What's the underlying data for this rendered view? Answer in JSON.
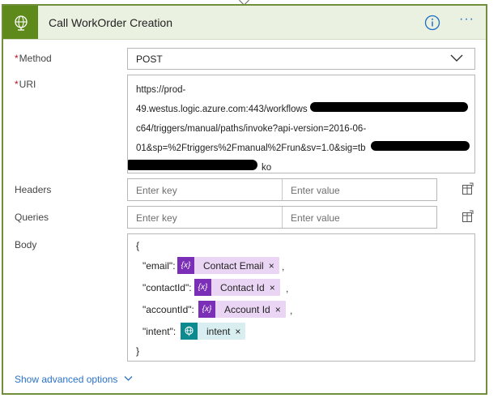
{
  "action": {
    "title": "Call WorkOrder Creation",
    "icon": "globe-icon",
    "info_icon": "info-icon",
    "more_label": "···"
  },
  "method": {
    "label": "Method",
    "required_mark": "*",
    "value": "POST"
  },
  "uri": {
    "label": "URI",
    "required_mark": "*",
    "lines": [
      "https://prod-",
      "49.westus.logic.azure.com:443/workflows",
      "c64/triggers/manual/paths/invoke?api-version=2016-06-",
      "01&sp=%2Ftriggers%2Fmanual%2Frun&sv=1.0&sig=tb",
      "ko"
    ]
  },
  "headers": {
    "label": "Headers",
    "key_placeholder": "Enter key",
    "value_placeholder": "Enter value"
  },
  "queries": {
    "label": "Queries",
    "key_placeholder": "Enter key",
    "value_placeholder": "Enter value"
  },
  "body": {
    "label": "Body",
    "open_brace": "{",
    "close_brace": "}",
    "fields": [
      {
        "key": "\"email\":",
        "token": "Contact Email",
        "token_type": "expression",
        "comma": ","
      },
      {
        "key": "\"contactId\":",
        "token": "Contact Id",
        "token_type": "expression",
        "comma": ","
      },
      {
        "key": "\"accountId\":",
        "token": "Account Id",
        "token_type": "expression",
        "comma": ","
      },
      {
        "key": "\"intent\":",
        "token": "intent",
        "token_type": "http",
        "comma": ""
      }
    ],
    "token_expression_icon": "{x}",
    "remove_glyph": "×"
  },
  "advanced": {
    "label": "Show advanced options"
  },
  "colors": {
    "header_bg": "#eaf1e1",
    "accent_green": "#5d8a1b",
    "border_green": "#6f8f3b",
    "link_blue": "#2b72c8",
    "token_purple": "#7a2fb6",
    "token_teal": "#0c8a8f"
  }
}
